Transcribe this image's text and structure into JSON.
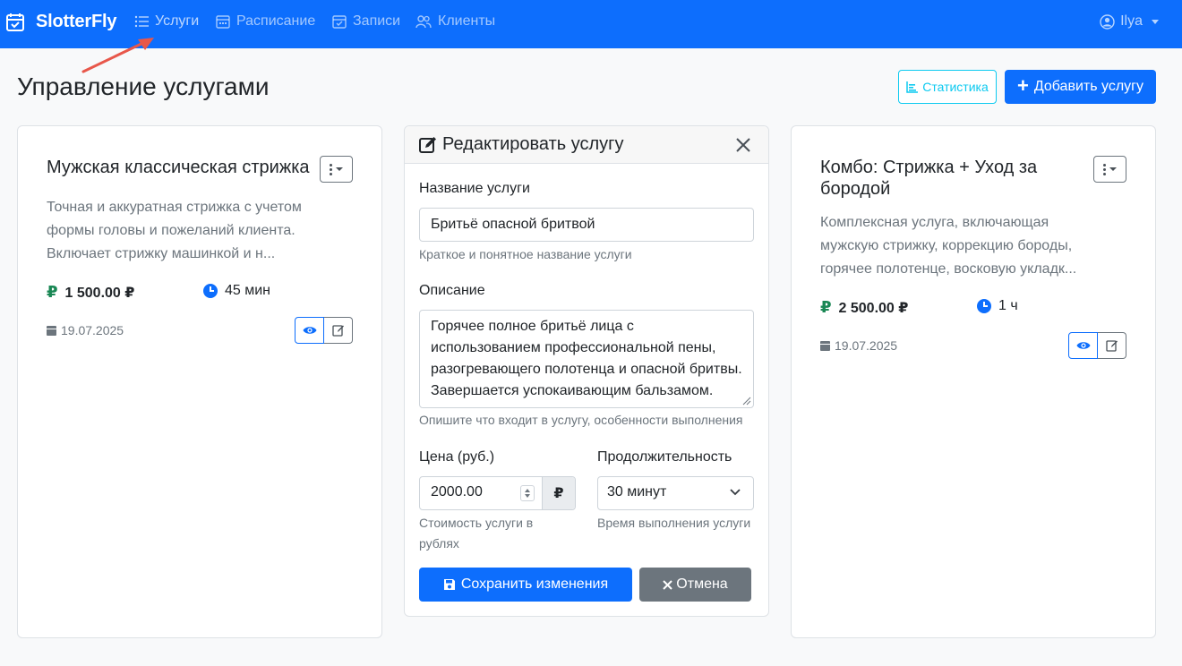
{
  "navbar": {
    "brand": "SlotterFly",
    "items": [
      {
        "label": "Услуги",
        "icon": "list-icon"
      },
      {
        "label": "Расписание",
        "icon": "schedule-icon"
      },
      {
        "label": "Записи",
        "icon": "calendar-check-icon"
      },
      {
        "label": "Клиенты",
        "icon": "people-icon"
      }
    ],
    "user": "Ilya"
  },
  "header": {
    "title": "Управление услугами",
    "stats_label": "Статистика",
    "add_label": "Добавить услугу"
  },
  "cards": [
    {
      "title": "Мужская классическая стрижка",
      "description": "Точная и аккуратная стрижка с учетом формы головы и пожеланий клиента. Включает стрижку машинкой и н...",
      "price": "1 500.00 ₽",
      "duration": "45 мин",
      "date": "19.07.2025"
    },
    {
      "title": "Комбо: Стрижка + Уход за бородой",
      "description": "Комплексная услуга, включающая мужскую стрижку, коррекцию бороды, горячее полотенце, восковую укладк...",
      "price": "2 500.00 ₽",
      "duration": "1 ч",
      "date": "19.07.2025"
    }
  ],
  "edit_form": {
    "title": "Редактировать услугу",
    "name_label": "Название услуги",
    "name_value": "Бритьё опасной бритвой",
    "name_hint": "Краткое и понятное название услуги",
    "desc_label": "Описание",
    "desc_value": "Горячее полное бритьё лица с использованием профессиональной пены, разогревающего полотенца и опасной бритвы. Завершается успокаивающим бальзамом.",
    "desc_hint": "Опишите что входит в услугу, особенности выполнения",
    "price_label": "Цена (руб.)",
    "price_value": "2000.00",
    "currency": "₽",
    "price_hint": "Стоимость услуги в рублях",
    "duration_label": "Продолжительность",
    "duration_value": "30 минут",
    "duration_hint": "Время выполнения услуги",
    "save_label": "Сохранить изменения",
    "cancel_label": "Отмена"
  },
  "colors": {
    "primary": "#0d6efd",
    "info": "#0dcaf0",
    "success": "#198754",
    "secondary": "#6c757d",
    "annotation_arrow": "#e8574a"
  }
}
